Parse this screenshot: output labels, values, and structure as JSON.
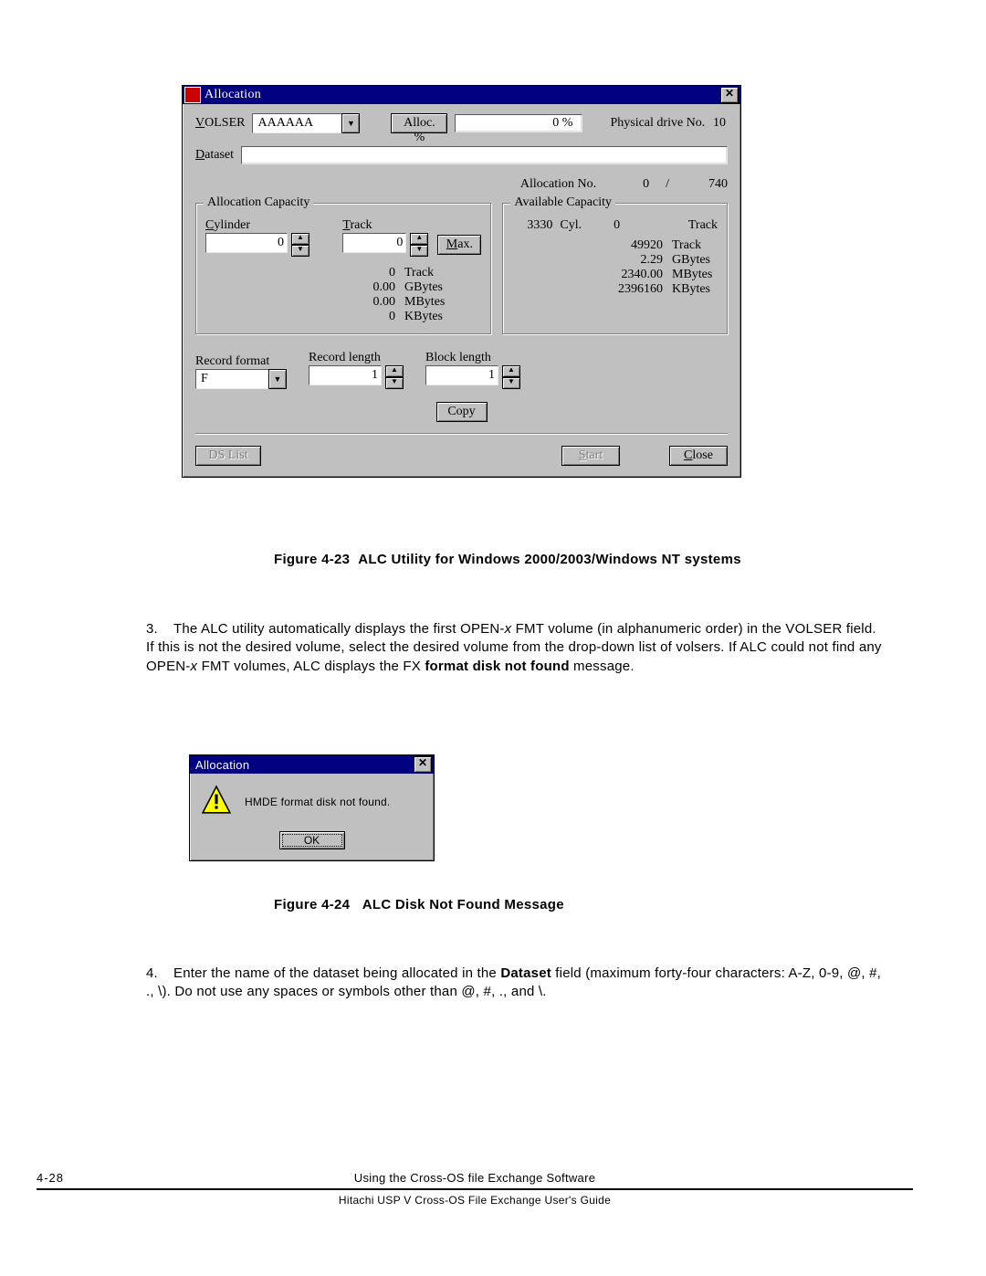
{
  "allocation_window": {
    "title": "Allocation",
    "close_glyph": "✕",
    "volser_label_pre": "V",
    "volser_label_post": "OLSER",
    "volser_value": "AAAAAA",
    "alloc_pct_label": "Alloc. %",
    "alloc_pct_value": "0 %",
    "phys_drive_label": "Physical drive No.",
    "phys_drive_value": "10",
    "dataset_label_pre": "D",
    "dataset_label_post": "ataset",
    "dataset_value": "",
    "alloc_no_label": "Allocation No.",
    "alloc_no_value": "0",
    "alloc_no_sep": "/",
    "alloc_no_total": "740",
    "group_alloc_cap": "Allocation Capacity",
    "cylinder_label_pre": "C",
    "cylinder_label_post": "ylinder",
    "cylinder_value": "0",
    "track_label_pre": "T",
    "track_label_post": "rack",
    "track_value": "0",
    "max_btn_pre": "M",
    "max_btn_post": "ax.",
    "cap_rows": [
      {
        "v": "0",
        "u": "Track"
      },
      {
        "v": "0.00",
        "u": "GBytes"
      },
      {
        "v": "0.00",
        "u": "MBytes"
      },
      {
        "v": "0",
        "u": "KBytes"
      }
    ],
    "group_avail_cap": "Available Capacity",
    "avail_cyl_value": "3330",
    "avail_cyl_label": "Cyl.",
    "avail_cyl_track_value": "0",
    "avail_cyl_track_label": "Track",
    "avail_rows": [
      {
        "v": "49920",
        "u": "Track"
      },
      {
        "v": "2.29",
        "u": "GBytes"
      },
      {
        "v": "2340.00",
        "u": "MBytes"
      },
      {
        "v": "2396160",
        "u": "KBytes"
      }
    ],
    "record_format_label": "Record format",
    "record_format_value": "F",
    "record_length_label": "Record length",
    "record_length_value": "1",
    "block_length_label": "Block length",
    "block_length_value": "1",
    "copy_btn": "Copy",
    "dslist_btn": "DS List",
    "start_btn_pre": "S",
    "start_btn_post": "tart",
    "close_btn_pre": "C",
    "close_btn_post": "lose"
  },
  "caption1_a": "Figure 4-23",
  "caption1_b": "ALC Utility for Windows 2000/2003/Windows NT systems",
  "para3_num": "3.",
  "para3_a": "The ALC utility automatically displays the first OPEN-",
  "para3_x": "x",
  "para3_b": " FMT volume (in alphanumeric order) in the VOLSER field. If this is not the desired volume, select the desired volume from the drop-down list of volsers. If ALC could not find any OPEN-",
  "para3_c": " FMT volumes, ALC displays the FX ",
  "para3_bold": "format disk not found",
  "para3_d": " message.",
  "msgbox": {
    "title": "Allocation",
    "text": "HMDE format disk not found.",
    "ok": "OK",
    "close_glyph": "✕"
  },
  "caption2_a": "Figure 4-24",
  "caption2_b": "ALC Disk Not Found Message",
  "para4_num": "4.",
  "para4_a": "Enter the name of the dataset being allocated in the ",
  "para4_bold": "Dataset",
  "para4_b": " field (maximum forty-four characters: A-Z, 0-9, @, #, ., \\). Do not use any spaces or symbols other than @, #, ., and \\.",
  "footer": {
    "page_no": "4-28",
    "mid": "Using the Cross-OS file Exchange Software",
    "bottom": "Hitachi USP V Cross-OS File Exchange User's Guide"
  }
}
